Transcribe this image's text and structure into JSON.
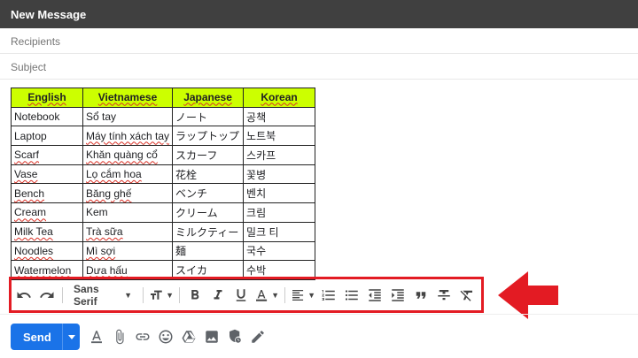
{
  "window": {
    "title": "New Message"
  },
  "fields": {
    "recipients_placeholder": "Recipients",
    "subject_placeholder": "Subject"
  },
  "table": {
    "headers": [
      "English",
      "Vietnamese",
      "Japanese",
      "Korean"
    ],
    "rows": [
      [
        "Notebook",
        "Sổ tay",
        "ノート",
        "공책"
      ],
      [
        "Laptop",
        "Máy tính xách tay",
        "ラップトップ",
        "노트북"
      ],
      [
        "Scarf",
        "Khăn quàng cổ",
        "スカーフ",
        "스카프"
      ],
      [
        "Vase",
        "Lọ cắm hoa",
        "花栓",
        "꽃병"
      ],
      [
        "Bench",
        "Băng ghế",
        "ベンチ",
        "벤치"
      ],
      [
        "Cream",
        "Kem",
        "クリーム",
        "크림"
      ],
      [
        "Milk Tea",
        "Trà sữa",
        "ミルクティー",
        "밀크 티"
      ],
      [
        "Noodles",
        "Mì sợi",
        "麺",
        "국수"
      ],
      [
        "Watermelon",
        "Dưa hấu",
        "スイカ",
        "수박"
      ]
    ]
  },
  "toolbar": {
    "font": "Sans Serif",
    "icons": [
      "undo-icon",
      "redo-icon",
      "font-size-icon",
      "bold-icon",
      "italic-icon",
      "underline-icon",
      "text-color-icon",
      "align-icon",
      "numbered-list-icon",
      "bulleted-list-icon",
      "indent-less-icon",
      "indent-more-icon",
      "quote-icon",
      "strikethrough-icon",
      "remove-formatting-icon"
    ]
  },
  "bottom": {
    "send_label": "Send"
  },
  "colors": {
    "highlight": "#e31b23",
    "send": "#1a73e8",
    "header_cell": "#ccff00"
  }
}
